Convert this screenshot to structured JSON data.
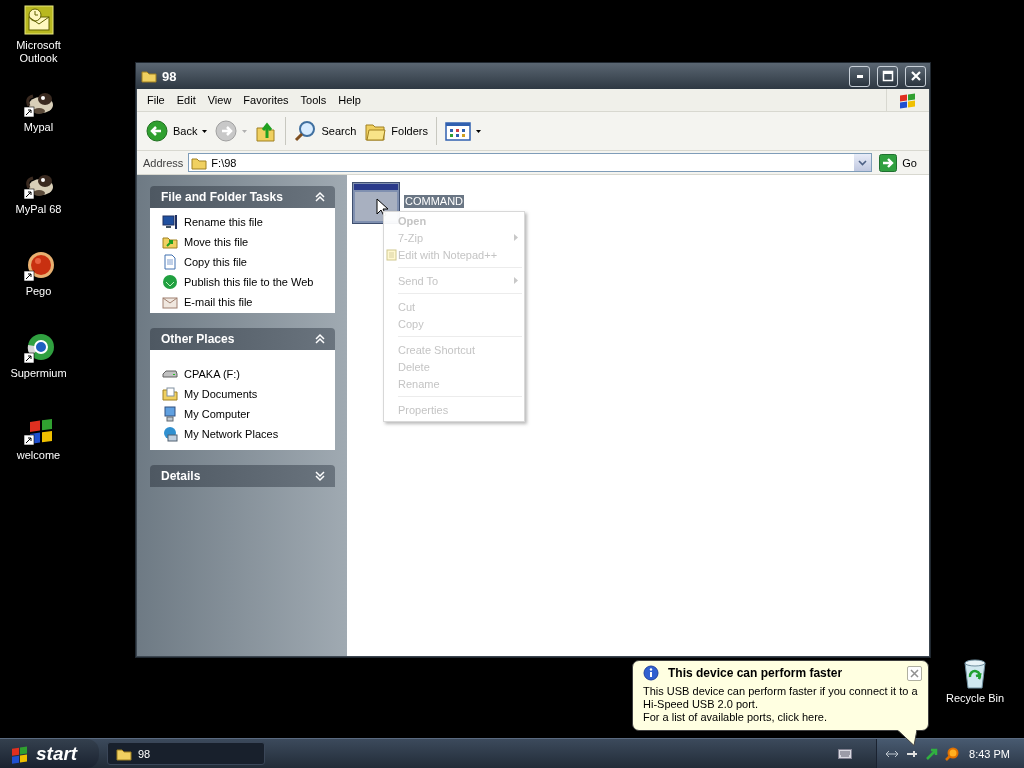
{
  "desktop_icons": [
    {
      "label": "Microsoft Outlook",
      "kind": "outlook",
      "shortcut": false
    },
    {
      "label": "Mypal",
      "kind": "mypal",
      "shortcut": true
    },
    {
      "label": "MyPal 68",
      "kind": "mypal",
      "shortcut": true
    },
    {
      "label": "Pego",
      "kind": "pego",
      "shortcut": true
    },
    {
      "label": "Supermium",
      "kind": "supermium",
      "shortcut": true
    },
    {
      "label": "welcome",
      "kind": "welcome",
      "shortcut": true
    }
  ],
  "window": {
    "title": "98",
    "menu": [
      "File",
      "Edit",
      "View",
      "Favorites",
      "Tools",
      "Help"
    ],
    "toolbar": [
      {
        "kind": "back",
        "label": "Back",
        "disabled": false
      },
      {
        "kind": "forward",
        "disabled": true
      },
      {
        "kind": "up",
        "disabled": false
      },
      {
        "kind": "search",
        "label": "Search",
        "disabled": false
      },
      {
        "kind": "folders",
        "label": "Folders",
        "disabled": false
      },
      {
        "kind": "views",
        "disabled": false
      }
    ],
    "address": {
      "label": "Address",
      "value": "F:\\98",
      "go": "Go"
    },
    "panels": [
      {
        "title": "File and Folder Tasks",
        "expanded": true,
        "items": [
          {
            "label": "Rename this file",
            "kind": "rename"
          },
          {
            "label": "Move this file",
            "kind": "move"
          },
          {
            "label": "Copy this file",
            "kind": "copy"
          },
          {
            "label": "Publish this file to the Web",
            "kind": "publish"
          },
          {
            "label": "E-mail this file",
            "kind": "email"
          }
        ]
      },
      {
        "title": "Other Places",
        "expanded": true,
        "items": [
          {
            "label": "CPAKA (F:)",
            "kind": "drive"
          },
          {
            "label": "My Documents",
            "kind": "documents"
          },
          {
            "label": "My Computer",
            "kind": "computer"
          },
          {
            "label": "My Network Places",
            "kind": "network"
          }
        ]
      },
      {
        "title": "Details",
        "expanded": false
      }
    ],
    "files": [
      {
        "name": "COMMAND",
        "selected": true
      }
    ]
  },
  "context_menu": [
    {
      "kind": "item",
      "label": "Open",
      "default": true,
      "submenu": false,
      "has_icon": false
    },
    {
      "kind": "item",
      "label": "7-Zip",
      "default": false,
      "submenu": true,
      "has_icon": false
    },
    {
      "kind": "item",
      "label": "Edit with Notepad++",
      "default": false,
      "submenu": false,
      "has_icon": true
    },
    {
      "kind": "separator"
    },
    {
      "kind": "item",
      "label": "Send To",
      "default": false,
      "submenu": true,
      "has_icon": false
    },
    {
      "kind": "separator"
    },
    {
      "kind": "item",
      "label": "Cut",
      "default": false,
      "submenu": false,
      "has_icon": false
    },
    {
      "kind": "item",
      "label": "Copy",
      "default": false,
      "submenu": false,
      "has_icon": false
    },
    {
      "kind": "separator"
    },
    {
      "kind": "item",
      "label": "Create Shortcut",
      "default": false,
      "submenu": false,
      "has_icon": false
    },
    {
      "kind": "item",
      "label": "Delete",
      "default": false,
      "submenu": false,
      "has_icon": false
    },
    {
      "kind": "item",
      "label": "Rename",
      "default": false,
      "submenu": false,
      "has_icon": false
    },
    {
      "kind": "separator"
    },
    {
      "kind": "item",
      "label": "Properties",
      "default": false,
      "submenu": false,
      "has_icon": false
    }
  ],
  "recycle_bin": {
    "label": "Recycle Bin"
  },
  "balloon": {
    "title": "This device can perform faster",
    "lines": [
      "This USB device can perform faster if you connect it to a Hi-Speed USB 2.0 port.",
      "For a list of available ports, click here."
    ]
  },
  "taskbar": {
    "start": "start",
    "tasks": [
      {
        "label": "98",
        "selected": true
      }
    ],
    "clock": "8:43 PM"
  }
}
